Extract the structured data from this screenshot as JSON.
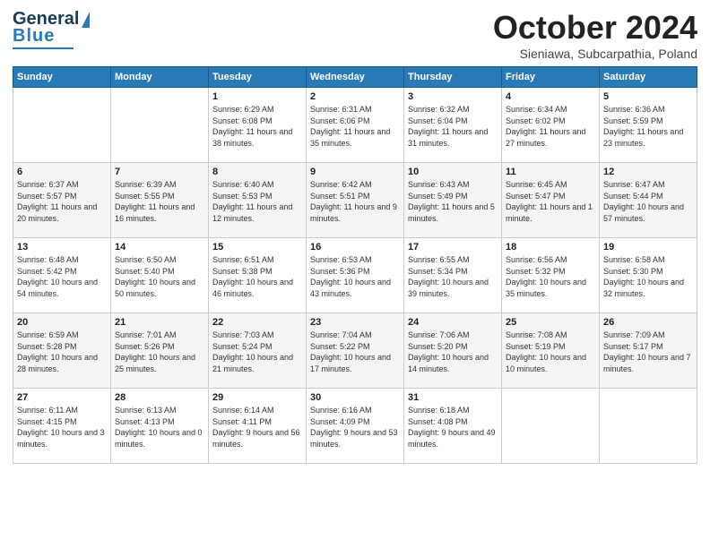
{
  "header": {
    "logo_line1": "General",
    "logo_line2": "Blue",
    "title": "October 2024",
    "location": "Sieniawa, Subcarpathia, Poland"
  },
  "days_of_week": [
    "Sunday",
    "Monday",
    "Tuesday",
    "Wednesday",
    "Thursday",
    "Friday",
    "Saturday"
  ],
  "weeks": [
    [
      {
        "day": "",
        "sunrise": "",
        "sunset": "",
        "daylight": ""
      },
      {
        "day": "",
        "sunrise": "",
        "sunset": "",
        "daylight": ""
      },
      {
        "day": "1",
        "sunrise": "Sunrise: 6:29 AM",
        "sunset": "Sunset: 6:08 PM",
        "daylight": "Daylight: 11 hours and 38 minutes."
      },
      {
        "day": "2",
        "sunrise": "Sunrise: 6:31 AM",
        "sunset": "Sunset: 6:06 PM",
        "daylight": "Daylight: 11 hours and 35 minutes."
      },
      {
        "day": "3",
        "sunrise": "Sunrise: 6:32 AM",
        "sunset": "Sunset: 6:04 PM",
        "daylight": "Daylight: 11 hours and 31 minutes."
      },
      {
        "day": "4",
        "sunrise": "Sunrise: 6:34 AM",
        "sunset": "Sunset: 6:02 PM",
        "daylight": "Daylight: 11 hours and 27 minutes."
      },
      {
        "day": "5",
        "sunrise": "Sunrise: 6:36 AM",
        "sunset": "Sunset: 5:59 PM",
        "daylight": "Daylight: 11 hours and 23 minutes."
      }
    ],
    [
      {
        "day": "6",
        "sunrise": "Sunrise: 6:37 AM",
        "sunset": "Sunset: 5:57 PM",
        "daylight": "Daylight: 11 hours and 20 minutes."
      },
      {
        "day": "7",
        "sunrise": "Sunrise: 6:39 AM",
        "sunset": "Sunset: 5:55 PM",
        "daylight": "Daylight: 11 hours and 16 minutes."
      },
      {
        "day": "8",
        "sunrise": "Sunrise: 6:40 AM",
        "sunset": "Sunset: 5:53 PM",
        "daylight": "Daylight: 11 hours and 12 minutes."
      },
      {
        "day": "9",
        "sunrise": "Sunrise: 6:42 AM",
        "sunset": "Sunset: 5:51 PM",
        "daylight": "Daylight: 11 hours and 9 minutes."
      },
      {
        "day": "10",
        "sunrise": "Sunrise: 6:43 AM",
        "sunset": "Sunset: 5:49 PM",
        "daylight": "Daylight: 11 hours and 5 minutes."
      },
      {
        "day": "11",
        "sunrise": "Sunrise: 6:45 AM",
        "sunset": "Sunset: 5:47 PM",
        "daylight": "Daylight: 11 hours and 1 minute."
      },
      {
        "day": "12",
        "sunrise": "Sunrise: 6:47 AM",
        "sunset": "Sunset: 5:44 PM",
        "daylight": "Daylight: 10 hours and 57 minutes."
      }
    ],
    [
      {
        "day": "13",
        "sunrise": "Sunrise: 6:48 AM",
        "sunset": "Sunset: 5:42 PM",
        "daylight": "Daylight: 10 hours and 54 minutes."
      },
      {
        "day": "14",
        "sunrise": "Sunrise: 6:50 AM",
        "sunset": "Sunset: 5:40 PM",
        "daylight": "Daylight: 10 hours and 50 minutes."
      },
      {
        "day": "15",
        "sunrise": "Sunrise: 6:51 AM",
        "sunset": "Sunset: 5:38 PM",
        "daylight": "Daylight: 10 hours and 46 minutes."
      },
      {
        "day": "16",
        "sunrise": "Sunrise: 6:53 AM",
        "sunset": "Sunset: 5:36 PM",
        "daylight": "Daylight: 10 hours and 43 minutes."
      },
      {
        "day": "17",
        "sunrise": "Sunrise: 6:55 AM",
        "sunset": "Sunset: 5:34 PM",
        "daylight": "Daylight: 10 hours and 39 minutes."
      },
      {
        "day": "18",
        "sunrise": "Sunrise: 6:56 AM",
        "sunset": "Sunset: 5:32 PM",
        "daylight": "Daylight: 10 hours and 35 minutes."
      },
      {
        "day": "19",
        "sunrise": "Sunrise: 6:58 AM",
        "sunset": "Sunset: 5:30 PM",
        "daylight": "Daylight: 10 hours and 32 minutes."
      }
    ],
    [
      {
        "day": "20",
        "sunrise": "Sunrise: 6:59 AM",
        "sunset": "Sunset: 5:28 PM",
        "daylight": "Daylight: 10 hours and 28 minutes."
      },
      {
        "day": "21",
        "sunrise": "Sunrise: 7:01 AM",
        "sunset": "Sunset: 5:26 PM",
        "daylight": "Daylight: 10 hours and 25 minutes."
      },
      {
        "day": "22",
        "sunrise": "Sunrise: 7:03 AM",
        "sunset": "Sunset: 5:24 PM",
        "daylight": "Daylight: 10 hours and 21 minutes."
      },
      {
        "day": "23",
        "sunrise": "Sunrise: 7:04 AM",
        "sunset": "Sunset: 5:22 PM",
        "daylight": "Daylight: 10 hours and 17 minutes."
      },
      {
        "day": "24",
        "sunrise": "Sunrise: 7:06 AM",
        "sunset": "Sunset: 5:20 PM",
        "daylight": "Daylight: 10 hours and 14 minutes."
      },
      {
        "day": "25",
        "sunrise": "Sunrise: 7:08 AM",
        "sunset": "Sunset: 5:19 PM",
        "daylight": "Daylight: 10 hours and 10 minutes."
      },
      {
        "day": "26",
        "sunrise": "Sunrise: 7:09 AM",
        "sunset": "Sunset: 5:17 PM",
        "daylight": "Daylight: 10 hours and 7 minutes."
      }
    ],
    [
      {
        "day": "27",
        "sunrise": "Sunrise: 6:11 AM",
        "sunset": "Sunset: 4:15 PM",
        "daylight": "Daylight: 10 hours and 3 minutes."
      },
      {
        "day": "28",
        "sunrise": "Sunrise: 6:13 AM",
        "sunset": "Sunset: 4:13 PM",
        "daylight": "Daylight: 10 hours and 0 minutes."
      },
      {
        "day": "29",
        "sunrise": "Sunrise: 6:14 AM",
        "sunset": "Sunset: 4:11 PM",
        "daylight": "Daylight: 9 hours and 56 minutes."
      },
      {
        "day": "30",
        "sunrise": "Sunrise: 6:16 AM",
        "sunset": "Sunset: 4:09 PM",
        "daylight": "Daylight: 9 hours and 53 minutes."
      },
      {
        "day": "31",
        "sunrise": "Sunrise: 6:18 AM",
        "sunset": "Sunset: 4:08 PM",
        "daylight": "Daylight: 9 hours and 49 minutes."
      },
      {
        "day": "",
        "sunrise": "",
        "sunset": "",
        "daylight": ""
      },
      {
        "day": "",
        "sunrise": "",
        "sunset": "",
        "daylight": ""
      }
    ]
  ]
}
